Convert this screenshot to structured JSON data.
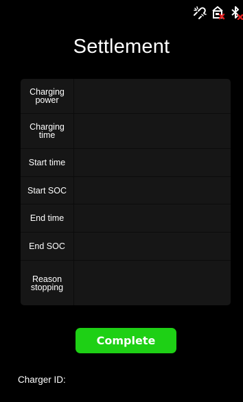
{
  "status_bar": {
    "icons": [
      {
        "name": "network-disconnected-icon"
      },
      {
        "name": "charger-error-icon"
      },
      {
        "name": "bluetooth-off-icon"
      }
    ],
    "error_color": "#e02020"
  },
  "title": "Settlement",
  "table": {
    "rows": [
      {
        "label": "Charging power",
        "value": ""
      },
      {
        "label": "Charging time",
        "value": ""
      },
      {
        "label": "Start time",
        "value": ""
      },
      {
        "label": "Start SOC",
        "value": ""
      },
      {
        "label": "End time",
        "value": ""
      },
      {
        "label": "End SOC",
        "value": ""
      },
      {
        "label": "Reason stopping",
        "value": ""
      }
    ]
  },
  "complete_button": {
    "label": "Complete",
    "color": "#1ed015"
  },
  "charger_id": {
    "label": "Charger ID:",
    "value": ""
  }
}
